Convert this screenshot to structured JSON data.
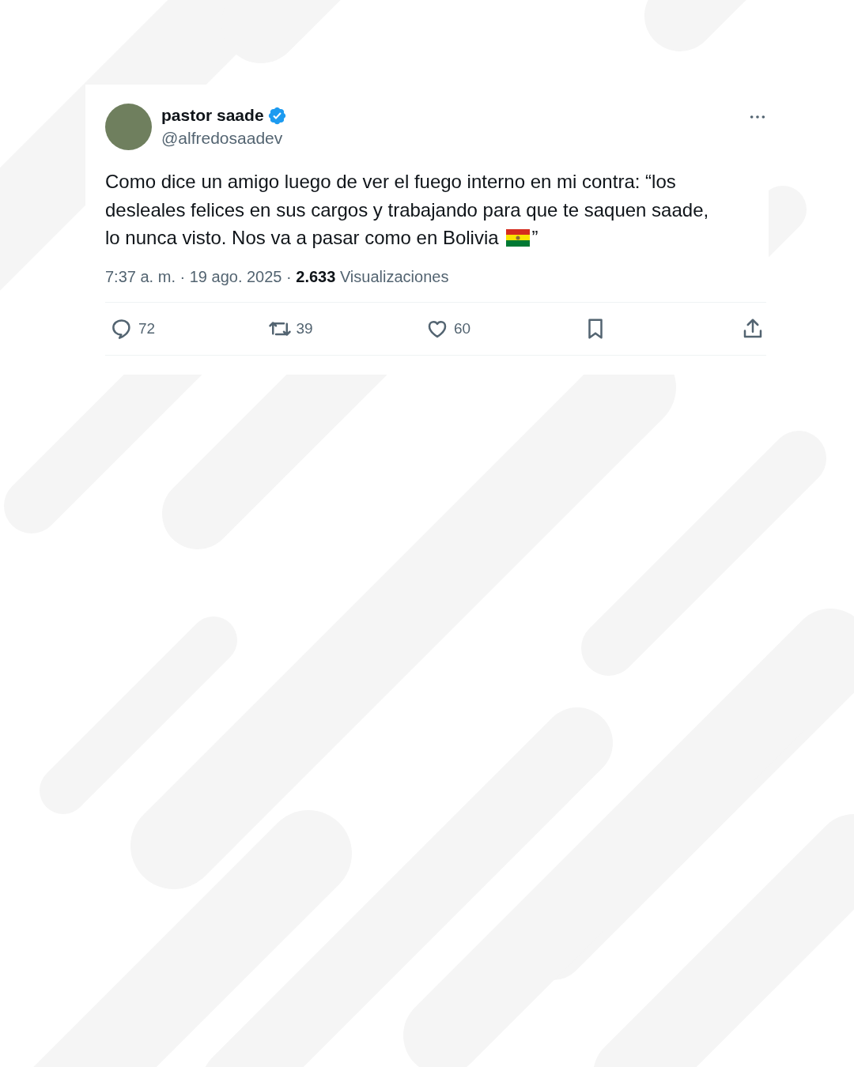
{
  "post": {
    "author": {
      "name": "pastor saade",
      "handle": "@alfredosaadev",
      "verified": true
    },
    "text_lines": [
      "Como dice un amigo luego de ver el fuego interno en mi contra: “los",
      "desleales felices en sus cargos y trabajando para que te saquen saade,",
      "lo nunca visto. Nos va a pasar como en Bolivia"
    ],
    "text_after_flag": "”",
    "meta": "7:37 a. m. · 19 ago. 2025 · **2.633** Visualizaciones",
    "actions": [
      {
        "kind": "reply",
        "count": "72"
      },
      {
        "kind": "repost",
        "count": "39"
      },
      {
        "kind": "like",
        "count": "60"
      },
      {
        "kind": "bookmark"
      },
      {
        "kind": "share"
      }
    ]
  }
}
